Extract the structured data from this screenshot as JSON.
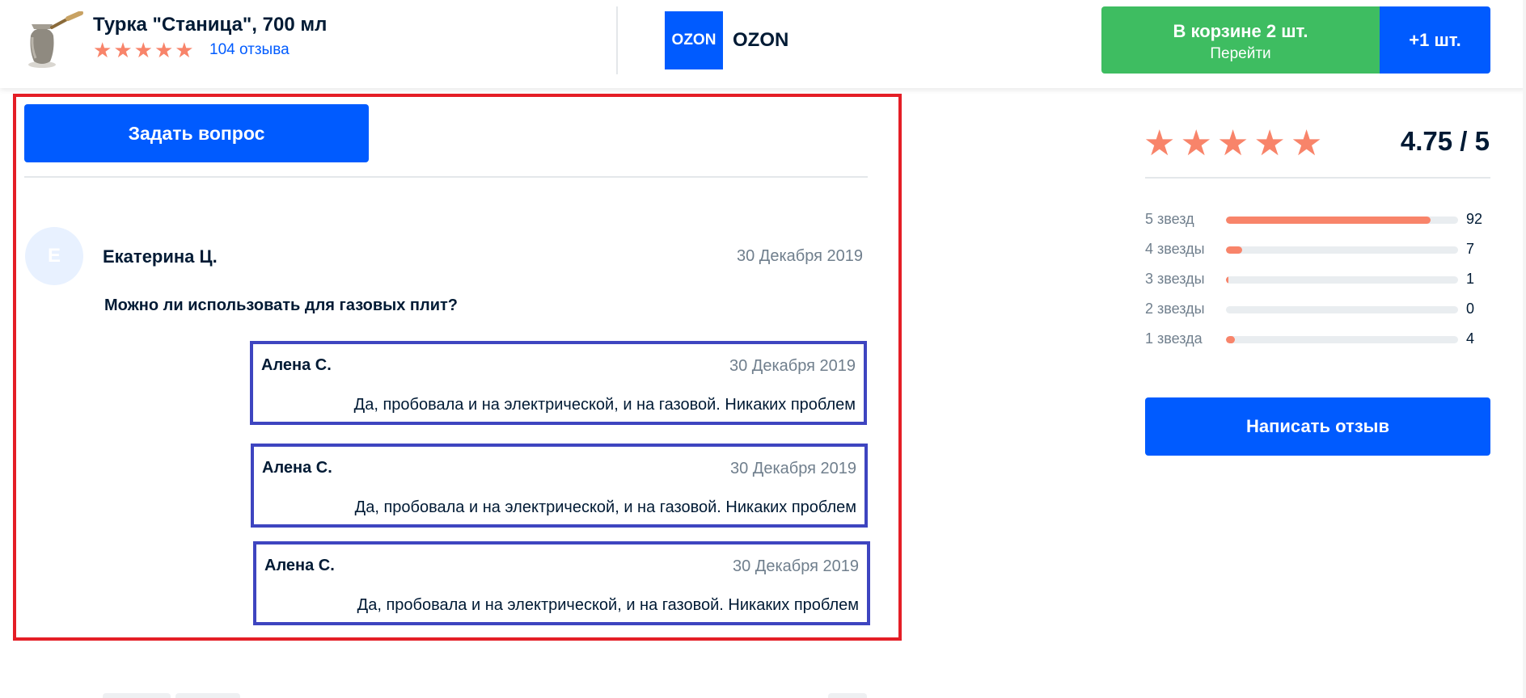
{
  "header": {
    "product_title": "Турка \"Станица\", 700 мл",
    "product_rating_stars": 5,
    "reviews_link": "104 отзыва",
    "seller_logo_text": "OZON",
    "seller_name": "OZON",
    "cart_title": "В корзине 2 шт.",
    "cart_action": "Перейти",
    "add_one_label": "+1 шт."
  },
  "qa": {
    "ask_button": "Задать вопрос",
    "question": {
      "avatar_letter": "Е",
      "author": "Екатерина Ц.",
      "date": "30 Декабря 2019",
      "text": "Можно ли использовать для газовых плит?"
    },
    "answers": [
      {
        "author": "Алена С.",
        "date": "30 Декабря 2019",
        "text": "Да, пробовала и на электрической, и на газовой. Никаких проблем"
      },
      {
        "author": "Алена С.",
        "date": "30 Декабря 2019",
        "text": "Да, пробовала и на электрической, и на газовой. Никаких проблем"
      },
      {
        "author": "Алена С.",
        "date": "30 Декабря 2019",
        "text": "Да, пробовала и на электрической, и на газовой. Никаких проблем"
      }
    ]
  },
  "rating": {
    "stars": 5,
    "value": "4.75 / 5",
    "distribution": [
      {
        "label": "5 звезд",
        "count": "92",
        "fraction": 0.88
      },
      {
        "label": "4 звезды",
        "count": "7",
        "fraction": 0.07
      },
      {
        "label": "3 звезды",
        "count": "1",
        "fraction": 0.01
      },
      {
        "label": "2 звезды",
        "count": "0",
        "fraction": 0
      },
      {
        "label": "1 звезда",
        "count": "4",
        "fraction": 0.04
      }
    ],
    "write_review_button": "Написать отзыв"
  },
  "colors": {
    "accent_blue": "#005bff",
    "cart_green": "#3ebd61",
    "star_orange": "#f8846a",
    "highlight_red": "#e41e26",
    "highlight_blue": "#3e45c0"
  }
}
